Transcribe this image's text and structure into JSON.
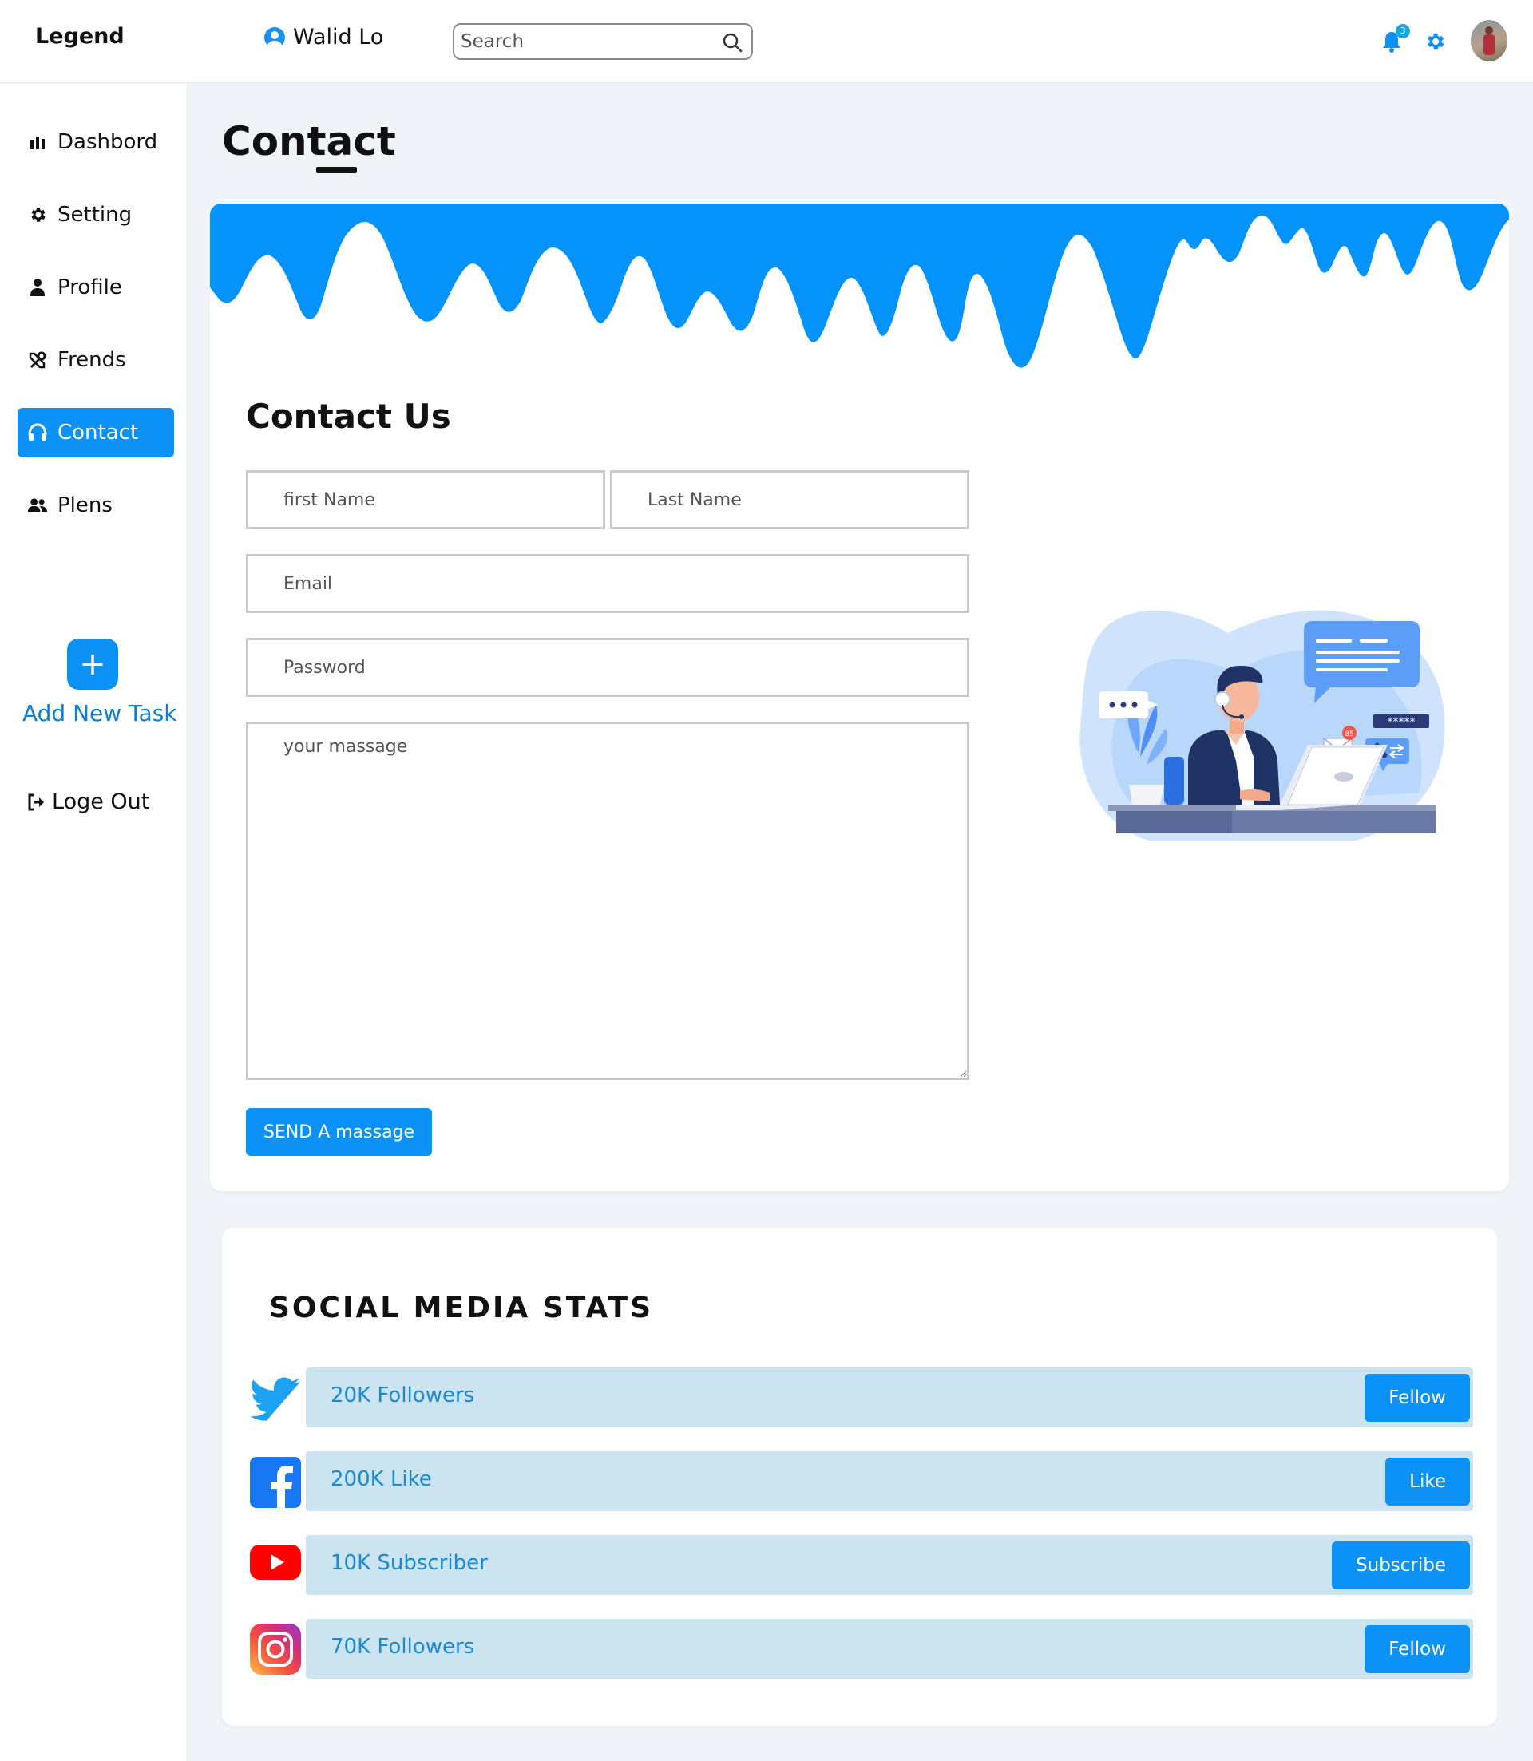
{
  "header": {
    "brand": "Legend",
    "user_name": "Walid Lo",
    "search_placeholder": "Search",
    "notification_count": "3"
  },
  "sidebar": {
    "items": [
      {
        "label": "Dashbord",
        "icon": "bar-chart-icon"
      },
      {
        "label": "Setting",
        "icon": "gear-icon"
      },
      {
        "label": "Profile",
        "icon": "user-icon"
      },
      {
        "label": "Frends",
        "icon": "tools-icon"
      },
      {
        "label": "Contact",
        "icon": "headset-icon",
        "active": true
      },
      {
        "label": "Plens",
        "icon": "users-icon"
      }
    ],
    "add_task_label": "Add New Task",
    "add_task_symbol": "+",
    "logout_label": "Loge Out"
  },
  "page": {
    "title": "Contact"
  },
  "contact_form": {
    "heading": "Contact Us",
    "first_name_placeholder": "first Name",
    "last_name_placeholder": "Last Name",
    "email_placeholder": "Email",
    "password_placeholder": "Password",
    "message_placeholder": "your massage",
    "send_label": "SEND A massage"
  },
  "illustration": {
    "badge_count": "85",
    "password_mask": "*****"
  },
  "social": {
    "title": "SOCIAL MEDIA STATS",
    "rows": [
      {
        "network": "twitter",
        "count": "20K Followers",
        "button": "Fellow"
      },
      {
        "network": "facebook",
        "count": "200K Like",
        "button": "Like"
      },
      {
        "network": "youtube",
        "count": "10K Subscriber",
        "button": "Subscribe"
      },
      {
        "network": "instagram",
        "count": "70K Followers",
        "button": "Fellow"
      }
    ]
  },
  "colors": {
    "accent": "#0c92f7",
    "page_bg": "#f0f3f7",
    "social_row_bg": "#cce4f0",
    "social_text": "#1a8ad4"
  }
}
